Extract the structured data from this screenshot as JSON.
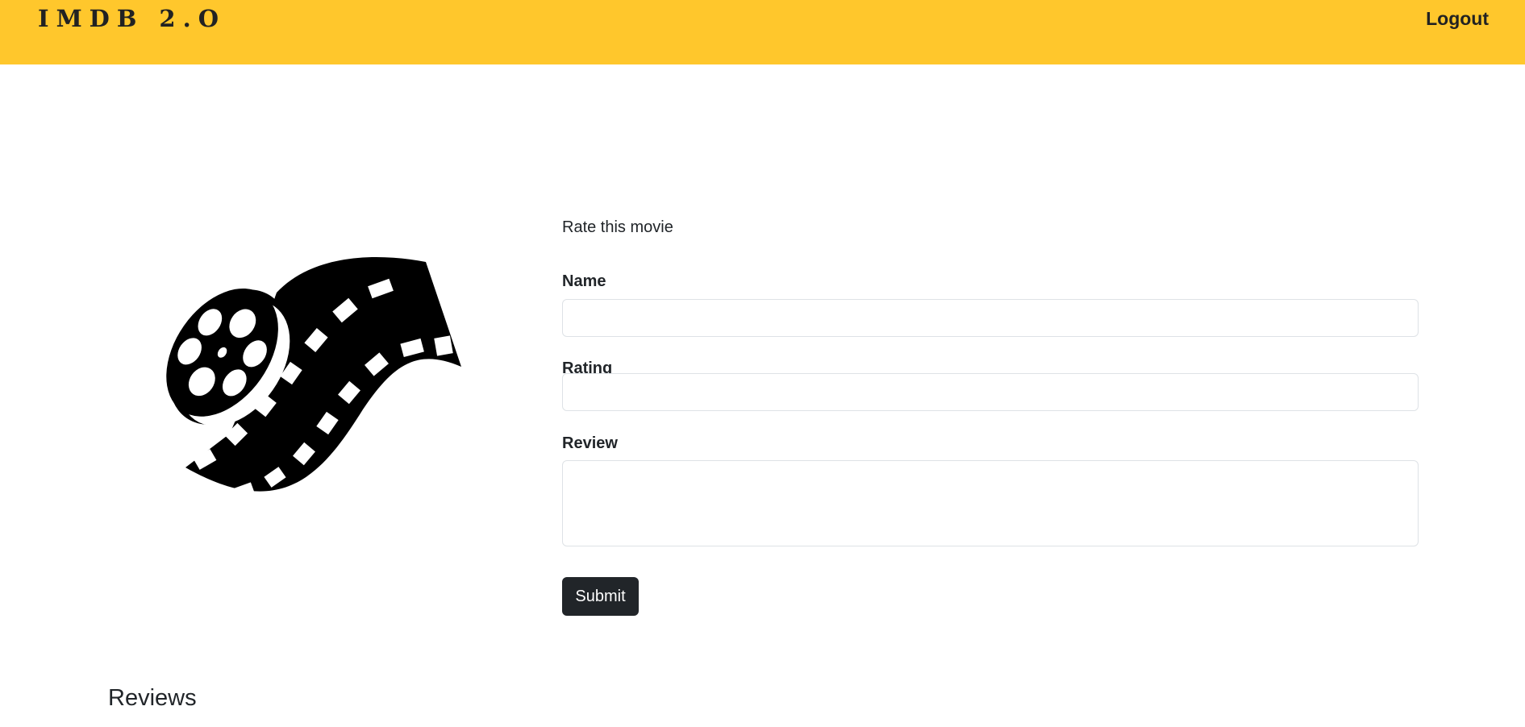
{
  "navbar": {
    "brand": "IMDB 2.O",
    "logout_label": "Logout",
    "background_color": "#ffc72c"
  },
  "hero": {
    "image_icon": "film-reel-icon"
  },
  "form": {
    "heading": "Rate this movie",
    "name_label": "Name",
    "name_value": "",
    "rating_label": "Rating",
    "rating_value": "",
    "review_label": "Review",
    "review_value": "",
    "submit_label": "Submit",
    "submit_color": "#212529"
  },
  "reviews": {
    "heading": "Reviews"
  }
}
